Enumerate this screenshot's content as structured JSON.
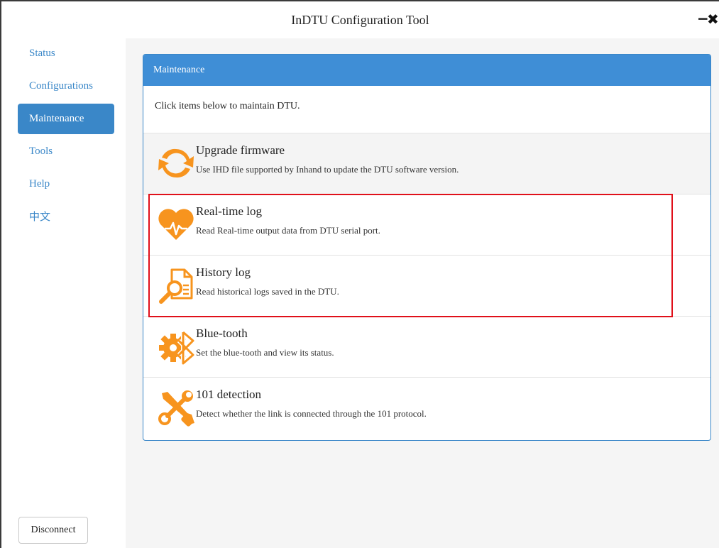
{
  "window": {
    "title": "InDTU Configuration Tool",
    "minimize_glyph": "−",
    "close_glyph": "✖"
  },
  "sidebar": {
    "items": [
      {
        "label": "Status",
        "active": false
      },
      {
        "label": "Configurations",
        "active": false
      },
      {
        "label": "Maintenance",
        "active": true
      },
      {
        "label": "Tools",
        "active": false
      },
      {
        "label": "Help",
        "active": false
      },
      {
        "label": "中文",
        "active": false
      }
    ],
    "disconnect_label": "Disconnect"
  },
  "panel": {
    "heading": "Maintenance",
    "intro": "Click items below to maintain DTU.",
    "items": [
      {
        "title": "Upgrade firmware",
        "description": "Use IHD file supported by Inhand to update the DTU software version.",
        "icon": "refresh-icon"
      },
      {
        "title": "Real-time log",
        "description": "Read Real-time output data from DTU serial port.",
        "icon": "heartbeat-icon"
      },
      {
        "title": "History log",
        "description": "Read historical logs saved in the DTU.",
        "icon": "file-search-icon"
      },
      {
        "title": "Blue-tooth",
        "description": "Set the blue-tooth and view its status.",
        "icon": "gear-bluetooth-icon"
      },
      {
        "title": "101 detection",
        "description": "Detect whether the link is connected through the 101 protocol.",
        "icon": "tools-icon"
      }
    ]
  },
  "colors": {
    "accent": "#3a87c8",
    "icon_orange": "#f7941e",
    "highlight": "#e0101a"
  }
}
